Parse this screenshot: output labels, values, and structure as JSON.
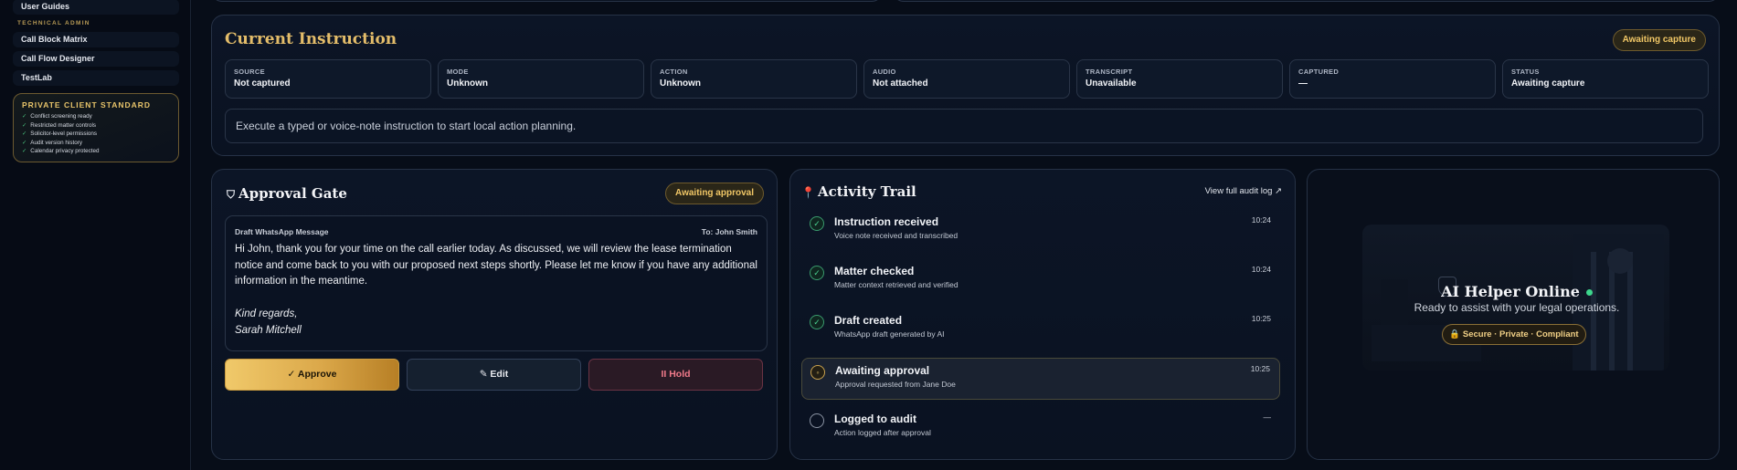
{
  "sidebar": {
    "items_top": [
      "User Guides"
    ],
    "section_label": "TECHNICAL ADMIN",
    "items": [
      "Call Block Matrix",
      "Call Flow Designer",
      "TestLab"
    ],
    "standard_card": {
      "title": "PRIVATE CLIENT STANDARD",
      "lines": [
        "Conflict screening ready",
        "Restricted matter controls",
        "Solicitor-level permissions",
        "Audit version history",
        "Calendar privacy protected"
      ]
    }
  },
  "current_instruction": {
    "title": "Current Instruction",
    "badge": "Awaiting capture",
    "fields": [
      {
        "label": "SOURCE",
        "value": "Not captured"
      },
      {
        "label": "MODE",
        "value": "Unknown"
      },
      {
        "label": "ACTION",
        "value": "Unknown"
      },
      {
        "label": "AUDIO",
        "value": "Not attached"
      },
      {
        "label": "TRANSCRIPT",
        "value": "Unavailable"
      },
      {
        "label": "CAPTURED",
        "value": "—"
      },
      {
        "label": "STATUS",
        "value": "Awaiting capture"
      }
    ],
    "instruction_text": "Execute a typed or voice-note instruction to start local action planning."
  },
  "approval_gate": {
    "title": "Approval Gate",
    "badge": "Awaiting approval",
    "draft_label": "Draft WhatsApp Message",
    "draft_to": "To: John Smith",
    "draft_body": "Hi John, thank you for your time on the call earlier today. As discussed, we will review the lease termination notice and come back to you with our proposed next steps shortly. Please let me know if you have any additional information in the meantime.",
    "sign_off": "Kind regards,",
    "signature": "Sarah Mitchell",
    "approve_label": "✓ Approve",
    "edit_label": "✎ Edit",
    "hold_label": "II Hold"
  },
  "activity_trail": {
    "title": "Activity Trail",
    "link": "View full audit log ↗",
    "steps": [
      {
        "title": "Instruction received",
        "sub": "Voice note received and transcribed",
        "time": "10:24",
        "state": "done"
      },
      {
        "title": "Matter checked",
        "sub": "Matter context retrieved and verified",
        "time": "10:24",
        "state": "done"
      },
      {
        "title": "Draft created",
        "sub": "WhatsApp draft generated by AI",
        "time": "10:25",
        "state": "done"
      },
      {
        "title": "Awaiting approval",
        "sub": "Approval requested from Jane Doe",
        "time": "10:25",
        "state": "wait"
      },
      {
        "title": "Logged to audit",
        "sub": "Action logged after approval",
        "time": "—",
        "state": "pending"
      }
    ]
  },
  "ai_helper": {
    "title": "AI Helper Online",
    "subtitle": "Ready to assist with your legal operations.",
    "pill": "🔒 Secure · Private · Compliant"
  }
}
